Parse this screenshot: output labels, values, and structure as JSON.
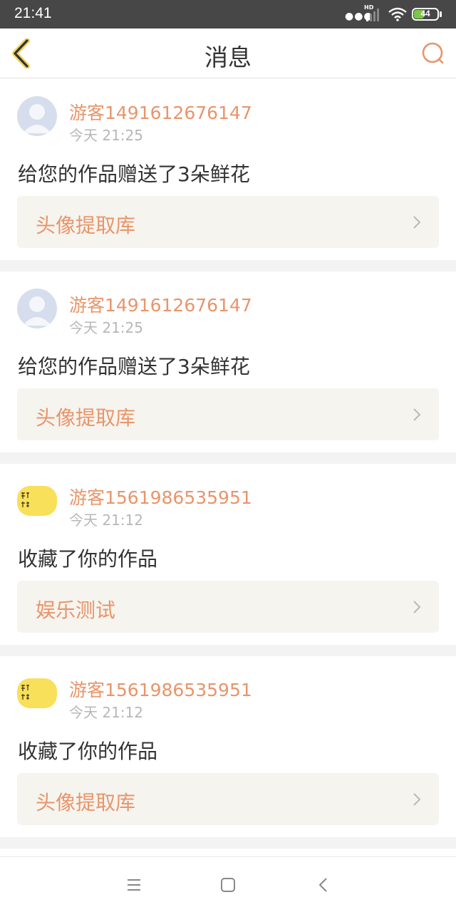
{
  "status_bar": {
    "time": "21:41",
    "network": "HD",
    "battery_level": "44",
    "battery_fraction": 0.44
  },
  "app_bar": {
    "title": "消息",
    "accent_color": "#e8956b"
  },
  "messages": [
    {
      "username": "游客1491612676147",
      "time": "今天 21:25",
      "action": "给您的作品赠送了3朵鲜花",
      "work": "头像提取库",
      "avatar": "default-user-icon"
    },
    {
      "username": "游客1491612676147",
      "time": "今天 21:25",
      "action": "给您的作品赠送了3朵鲜花",
      "work": "头像提取库",
      "avatar": "default-user-icon"
    },
    {
      "username": "游客1561986535951",
      "time": "今天 21:12",
      "action": "收藏了你的作品",
      "work": "娱乐测试",
      "avatar": "yellow-calligraphy-avatar"
    },
    {
      "username": "游客1561986535951",
      "time": "今天 21:12",
      "action": "收藏了你的作品",
      "work": "头像提取库",
      "avatar": "yellow-calligraphy-avatar"
    }
  ],
  "nav_bar": {
    "buttons": [
      "menu-icon",
      "home-square-icon",
      "back-triangle-icon"
    ]
  }
}
